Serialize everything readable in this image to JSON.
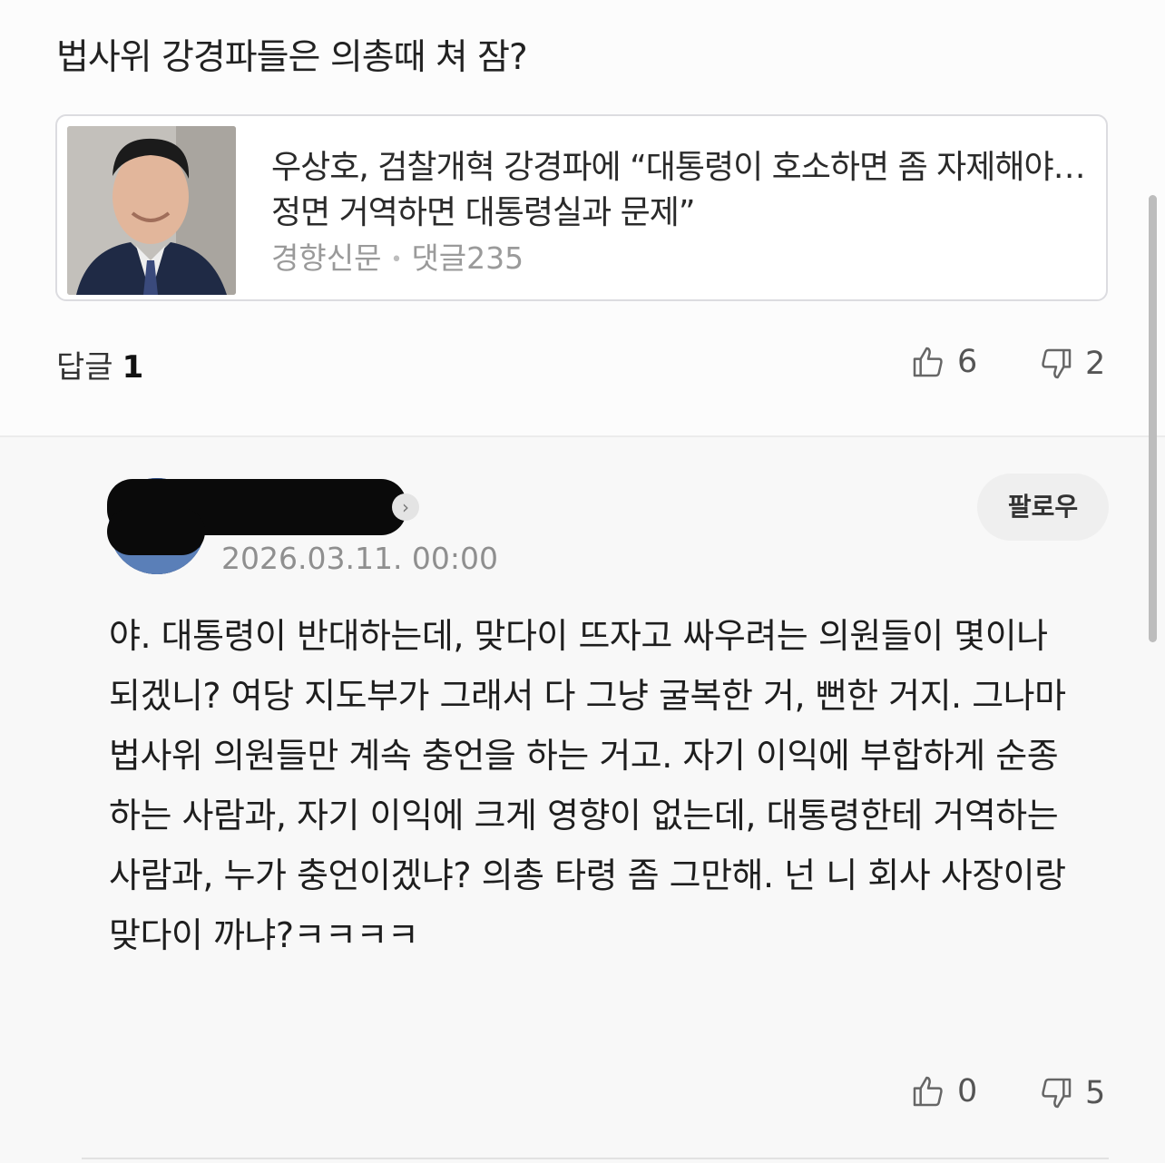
{
  "post": {
    "title": "법사위 강경파들은 의총때 쳐 잠?"
  },
  "article_card": {
    "headline": "우상호, 검찰개혁 강경파에 “대통령이 호소하면 좀 자제해야…정면 거역하면 대통령실과 문제”",
    "source": "경향신문",
    "separator": "•",
    "comments": "댓글235"
  },
  "post_footer": {
    "replies_label": "답글",
    "replies_count": "1",
    "likes": "6",
    "dislikes": "2"
  },
  "reply": {
    "date": "2026.03.11. 00:00",
    "follow_label": "팔로우",
    "profile_chevron": "›",
    "text": "야. 대통령이 반대하는데, 맞다이 뜨자고 싸우려는 의원들이 몇이나 되겠니? 여당 지도부가 그래서 다 그냥 굴복한 거, 뻔한 거지. 그나마 법사위 의원들만 계속 충언을 하는 거고. 자기 이익에 부합하게 순종하는 사람과, 자기 이익에 크게 영향이 없는데, 대통령한테 거역하는 사람과, 누가 충언이겠냐? 의총 타령 좀 그만해. 넌 니 회사 사장이랑 맞다이 까냐?ㅋㅋㅋㅋ",
    "likes": "0",
    "dislikes": "5"
  },
  "icons": {
    "like": "thumbs-up-icon",
    "dislike": "thumbs-down-icon",
    "chevron": "chevron-right-icon"
  }
}
